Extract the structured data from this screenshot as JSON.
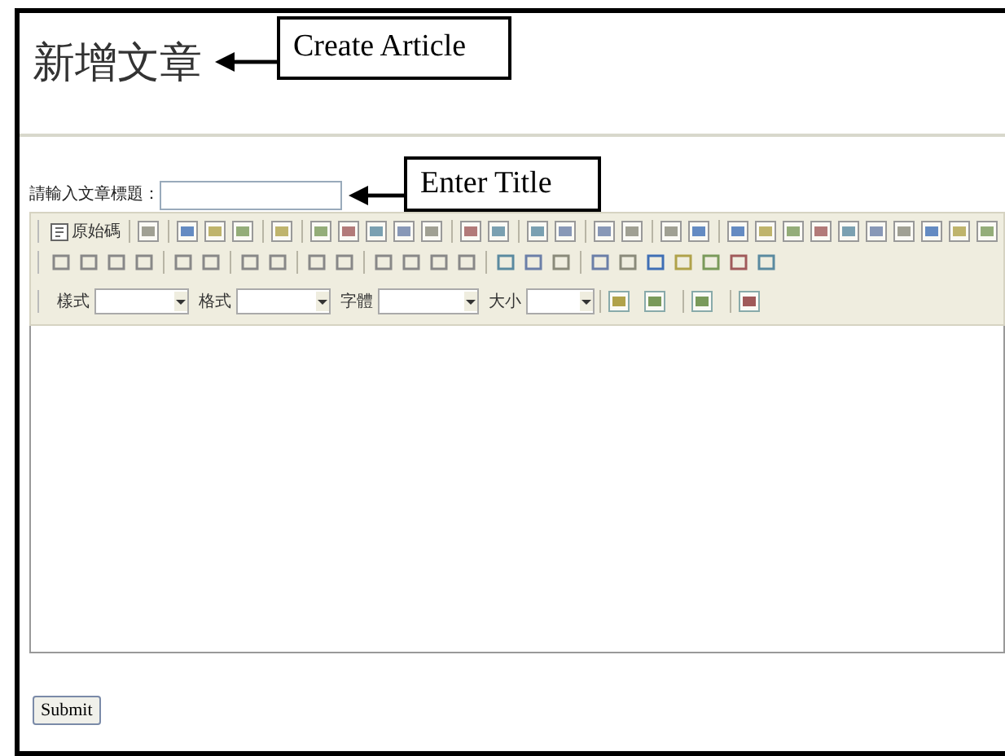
{
  "heading": "新增文章",
  "callouts": [
    {
      "text": "Create Article"
    },
    {
      "text": "Enter Title"
    }
  ],
  "title_field": {
    "label": "請輸入文章標題："
  },
  "toolbar": {
    "source_button": "原始碼",
    "dropdowns": [
      {
        "label": "樣式"
      },
      {
        "label": "格式"
      },
      {
        "label": "字體"
      },
      {
        "label": "大小"
      }
    ]
  },
  "submit_button": "Submit"
}
